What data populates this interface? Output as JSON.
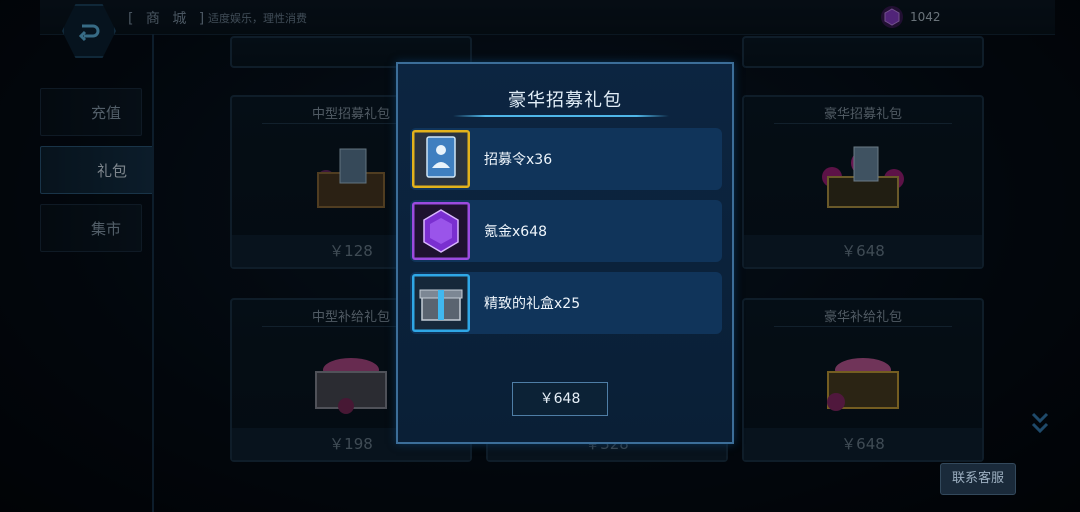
{
  "header": {
    "title": "[ 商 城 ]",
    "subtitle": "适度娱乐，理性消费",
    "currency_value": "1042"
  },
  "sidebar": {
    "items": [
      {
        "label": "充值",
        "active": false
      },
      {
        "label": "礼包",
        "active": true
      },
      {
        "label": "集市",
        "active": false
      }
    ]
  },
  "cards": [
    {
      "title": "中型招募礼包",
      "price": "￥128"
    },
    {
      "title": "豪华招募礼包",
      "price": "￥648"
    },
    {
      "title": "中型补给礼包",
      "price": "￥198"
    },
    {
      "title": "",
      "price": "￥328"
    },
    {
      "title": "豪华补给礼包",
      "price": "￥648"
    }
  ],
  "modal": {
    "title": "豪华招募礼包",
    "items": [
      {
        "label": "招募令x36",
        "icon": "recruit-card-icon",
        "frame_color": "#e3b21c"
      },
      {
        "label": "氪金x648",
        "icon": "purple-gem-icon",
        "frame_color": "#9b4be0"
      },
      {
        "label": "精致的礼盒x25",
        "icon": "gift-box-icon",
        "frame_color": "#2fa7e6"
      }
    ],
    "buy_label": "￥648"
  },
  "support_label": "联系客服",
  "colors": {
    "accent": "#4fb6e8",
    "modal_bg": "#0b2240",
    "row_bg": "#10345a"
  }
}
